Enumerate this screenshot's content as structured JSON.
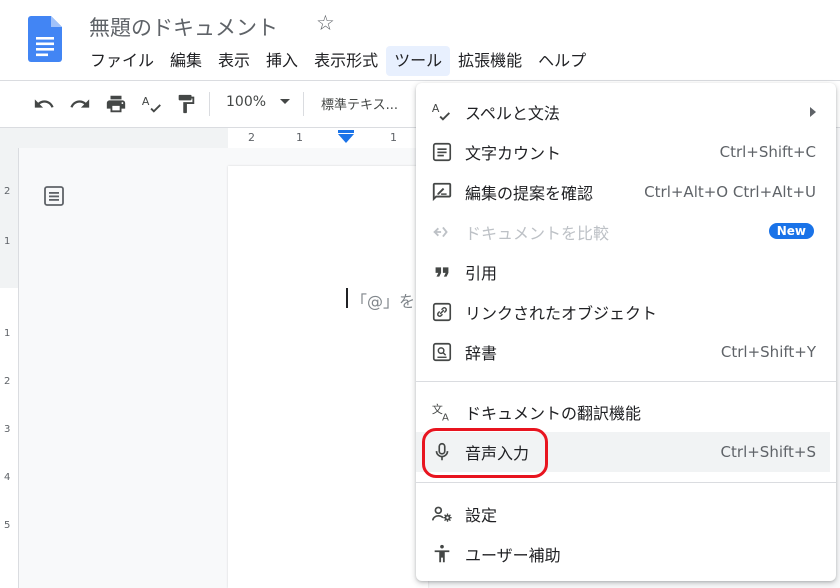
{
  "document": {
    "title": "無題のドキュメント",
    "star_icon": "star-outline-icon",
    "logo_icon": "google-docs-icon"
  },
  "menubar": [
    {
      "label": "ファイル"
    },
    {
      "label": "編集"
    },
    {
      "label": "表示"
    },
    {
      "label": "挿入"
    },
    {
      "label": "表示形式"
    },
    {
      "label": "ツール",
      "active": true
    },
    {
      "label": "拡張機能"
    },
    {
      "label": "ヘルプ"
    }
  ],
  "toolbar": {
    "zoom": "100%",
    "style": "標準テキス..."
  },
  "ruler": {
    "marks": [
      "2",
      "1",
      "1"
    ]
  },
  "vruler": {
    "marks": [
      "2",
      "1",
      "1",
      "2",
      "3",
      "4",
      "5"
    ]
  },
  "editor": {
    "placeholder": "「@」を"
  },
  "tools_menu": {
    "items": [
      {
        "label": "スペルと文法",
        "icon": "spellcheck-icon",
        "submenu": true
      },
      {
        "label": "文字カウント",
        "icon": "word-count-icon",
        "shortcut": "Ctrl+Shift+C"
      },
      {
        "label": "編集の提案を確認",
        "icon": "review-edits-icon",
        "shortcut": "Ctrl+Alt+O Ctrl+Alt+U"
      },
      {
        "label": "ドキュメントを比較",
        "icon": "compare-icon",
        "badge": "New",
        "disabled": true
      },
      {
        "label": "引用",
        "icon": "quote-icon"
      },
      {
        "label": "リンクされたオブジェクト",
        "icon": "linked-objects-icon"
      },
      {
        "label": "辞書",
        "icon": "dictionary-icon",
        "shortcut": "Ctrl+Shift+Y"
      },
      {
        "label": "ドキュメントの翻訳機能",
        "icon": "translate-icon"
      },
      {
        "label": "音声入力",
        "icon": "microphone-icon",
        "shortcut": "Ctrl+Shift+S",
        "highlighted": true
      },
      {
        "label": "設定",
        "icon": "preferences-icon"
      },
      {
        "label": "ユーザー補助",
        "icon": "accessibility-icon"
      }
    ]
  },
  "colors": {
    "accent": "#1a73e8",
    "annotation": "#e8141f",
    "menu_highlight": "#e8f0fe"
  }
}
